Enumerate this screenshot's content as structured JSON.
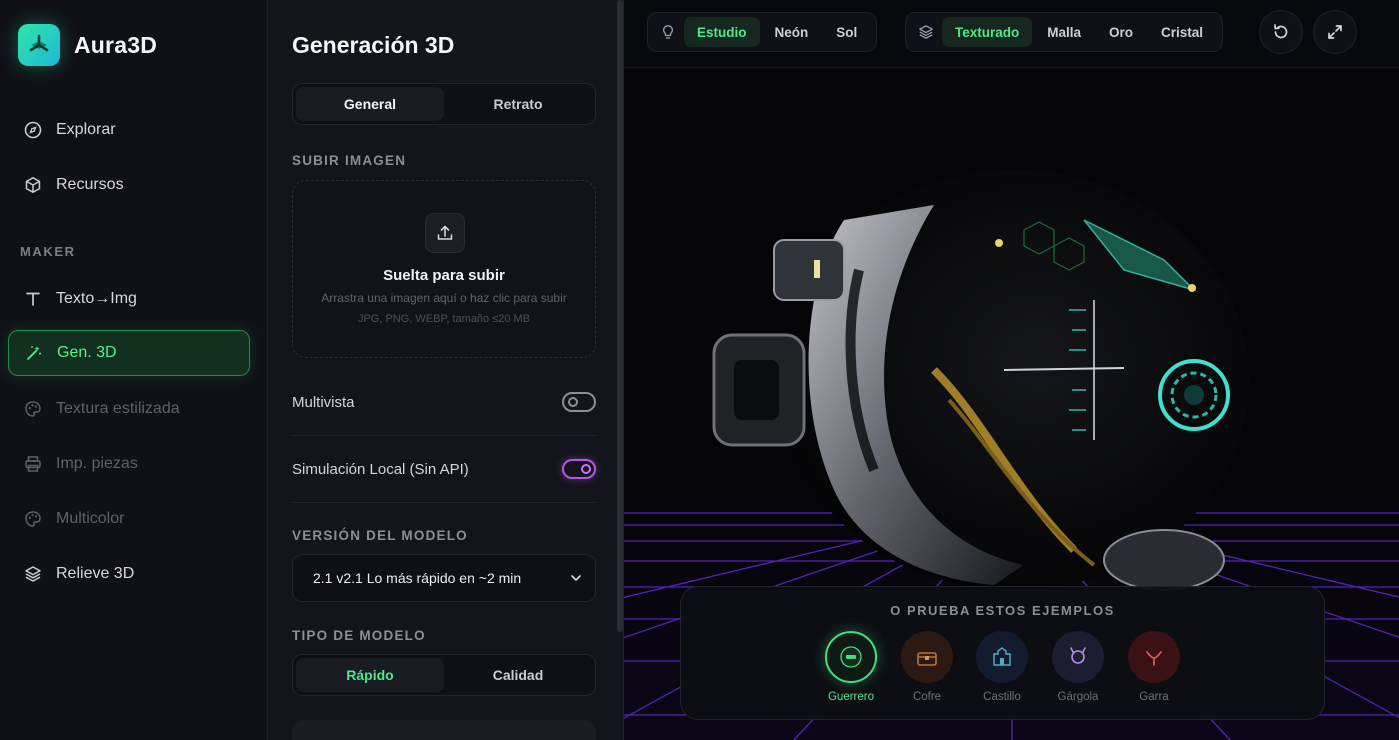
{
  "app": {
    "name": "Aura3D"
  },
  "sidebar": {
    "top_items": [
      {
        "label": "Explorar",
        "icon": "compass-icon"
      },
      {
        "label": "Recursos",
        "icon": "cube-icon"
      }
    ],
    "section_label": "MAKER",
    "maker_items": [
      {
        "label": "Texto→Img",
        "icon": "text-icon"
      },
      {
        "label": "Gen. 3D",
        "icon": "magic-wand-icon"
      },
      {
        "label": "Textura estilizada",
        "icon": "palette-icon"
      },
      {
        "label": "Imp. piezas",
        "icon": "printer-icon"
      },
      {
        "label": "Multicolor",
        "icon": "palette-icon"
      },
      {
        "label": "Relieve 3D",
        "icon": "layers-icon"
      }
    ]
  },
  "panel": {
    "title": "Generación 3D",
    "mode_tabs": [
      "General",
      "Retrato"
    ],
    "upload_label": "SUBIR IMAGEN",
    "upload": {
      "title": "Suelta para subir",
      "subtitle": "Arrastra una imagen aquí o haz clic para subir",
      "formats": "JPG, PNG, WEBP, tamaño ≤20 MB"
    },
    "multiview_label": "Multivista",
    "local_sim_label": "Simulación Local (Sin API)",
    "model_version_label": "VERSIÓN DEL MODELO",
    "model_version_value": "2.1 v2.1 Lo más rápido en ~2 min",
    "model_type_label": "TIPO DE MODELO",
    "model_type_tabs": [
      "Rápido",
      "Calidad"
    ]
  },
  "viewport": {
    "lighting": [
      "Estudio",
      "Neón",
      "Sol"
    ],
    "materials": [
      "Texturado",
      "Malla",
      "Oro",
      "Cristal"
    ],
    "examples_title": "O PRUEBA ESTOS EJEMPLOS",
    "examples": [
      "Guerrero",
      "Cofre",
      "Castillo",
      "Gárgola",
      "Garra"
    ]
  },
  "colors": {
    "accent_green": "#4fe78a",
    "accent_purple": "#b455f0",
    "grid_purple": "#6b2fd6"
  }
}
